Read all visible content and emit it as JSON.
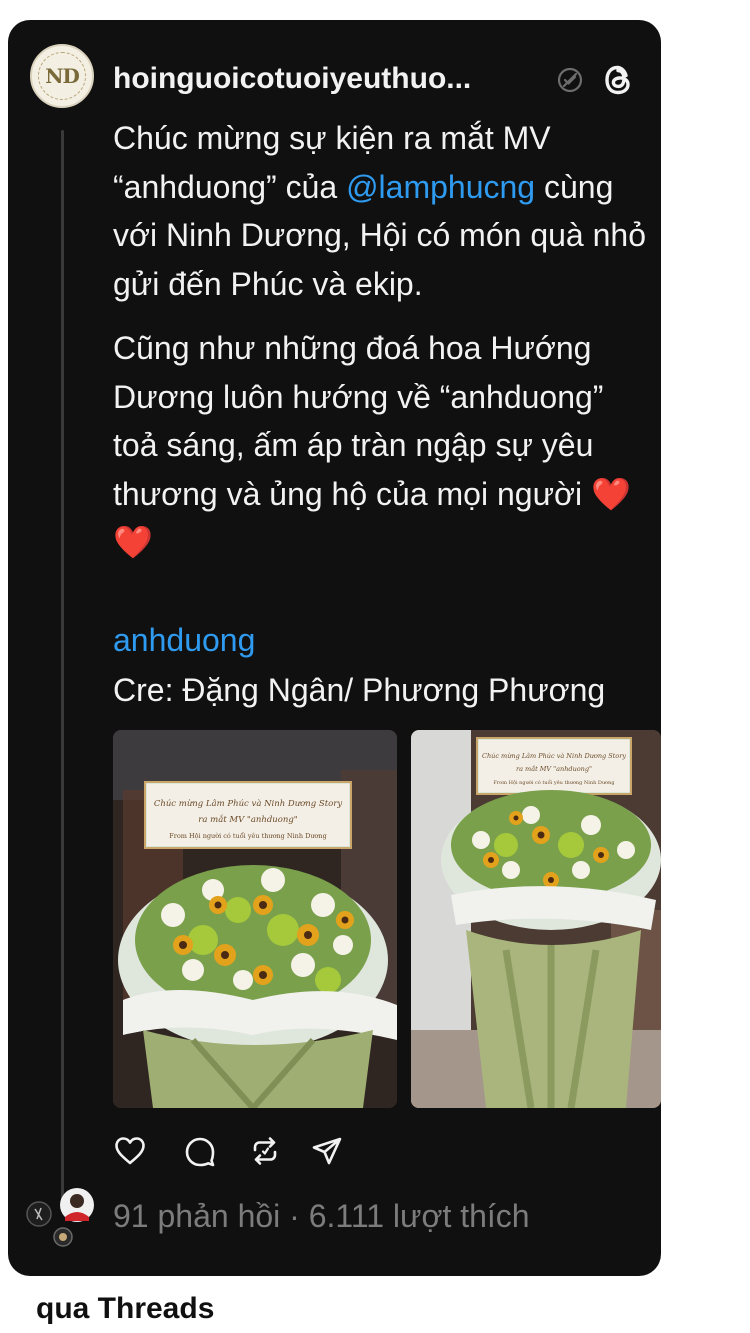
{
  "post": {
    "username": "hoinguoicotuoiyeuthuo...",
    "avatar_text": "ND",
    "text_p1_part1": "Chúc mừng sự kiện ra mắt MV “anhduong” của ",
    "mention": "@lamphucng",
    "text_p1_part2": " cùng với Ninh Dương, Hội có món quà nhỏ gửi đến Phúc và ekip.",
    "text_p2": "Cũng như những đoá hoa Hướng Dương luôn hướng về “anhduong” toả sáng, ấm áp tràn ngập sự yêu thương và ủng hộ của mọi người",
    "hearts": "❤️ ❤️",
    "hashtag": "anhduong",
    "credit": "Cre: Đặng Ngân/ Phương Phương",
    "photo_1": {
      "banner_line1": "Chúc mừng Lâm Phúc và Ninh Dương Story",
      "banner_line2": "ra mắt MV \"anhduong\"",
      "banner_line3": "From Hội người có tuổi yêu thương Ninh Dương"
    },
    "photo_2": {
      "banner_line1": "Chúc mừng Lâm Phúc và Ninh Dương Story",
      "banner_line2": "ra mắt MV \"anhduong\"",
      "banner_line3": "From Hội người có tuổi yêu thương Ninh Dương"
    },
    "stats": "91 phản hồi · 6.111 lượt thích"
  },
  "icons": [
    "verified-icon",
    "threads-logo-icon",
    "heart-icon",
    "comment-icon",
    "repost-icon",
    "share-icon"
  ],
  "caption": "qua Threads",
  "colors": {
    "card": "#101010",
    "text": "#f2f2f2",
    "link": "#2f9bf0",
    "muted": "#7c7c7c"
  }
}
